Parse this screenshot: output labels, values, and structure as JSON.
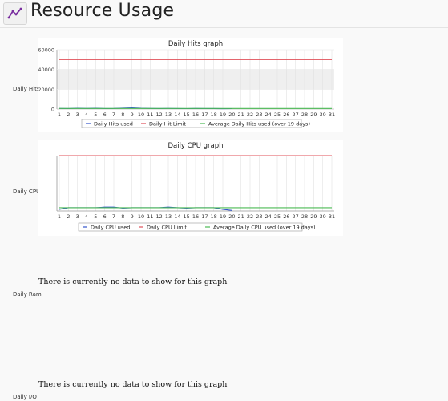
{
  "header": {
    "title": "Resource Usage",
    "icon": "chart-line-icon"
  },
  "rows": {
    "hits": {
      "label": "Daily Hits"
    },
    "cpu": {
      "label": "Daily CPU"
    },
    "ram": {
      "label": "Daily Ram",
      "no_data": "There is currently no data to show for this graph"
    },
    "io": {
      "label": "Daily I/O",
      "no_data": "There is currently no data to show for this graph"
    }
  },
  "chart_data": [
    {
      "type": "line",
      "title": "Daily Hits graph",
      "ylim": [
        0,
        60000
      ],
      "y_ticks": [
        "0",
        "20000",
        "40000",
        "60000"
      ],
      "x": [
        "1",
        "2",
        "3",
        "4",
        "5",
        "6",
        "7",
        "8",
        "9",
        "10",
        "11",
        "12",
        "13",
        "14",
        "15",
        "16",
        "17",
        "18",
        "19",
        "20",
        "21",
        "22",
        "23",
        "24",
        "25",
        "26",
        "27",
        "28",
        "29",
        "30",
        "31"
      ],
      "series": [
        {
          "name": "Daily Hits used",
          "color": "#3355cc",
          "values": [
            600,
            500,
            700,
            600,
            700,
            500,
            600,
            900,
            1100,
            700,
            600,
            500,
            600,
            500,
            400,
            600,
            500,
            500,
            300,
            400,
            null,
            null,
            null,
            null,
            null,
            null,
            null,
            null,
            null,
            null,
            null
          ]
        },
        {
          "name": "Daily Hit Limit",
          "color": "#e0505a",
          "values": [
            50000,
            50000,
            50000,
            50000,
            50000,
            50000,
            50000,
            50000,
            50000,
            50000,
            50000,
            50000,
            50000,
            50000,
            50000,
            50000,
            50000,
            50000,
            50000,
            50000,
            50000,
            50000,
            50000,
            50000,
            50000,
            50000,
            50000,
            50000,
            50000,
            50000,
            50000
          ]
        },
        {
          "name": "Average Daily Hits used (over 19 days)",
          "color": "#4cbb55",
          "values": [
            550,
            550,
            550,
            550,
            550,
            550,
            550,
            550,
            550,
            550,
            550,
            550,
            550,
            550,
            550,
            550,
            550,
            550,
            550,
            550,
            550,
            550,
            550,
            550,
            550,
            550,
            550,
            550,
            550,
            550,
            550
          ]
        }
      ],
      "grid": true,
      "legend_position": "bottom"
    },
    {
      "type": "line",
      "title": "Daily CPU graph",
      "ylim": [
        0,
        100
      ],
      "x": [
        "1",
        "2",
        "3",
        "4",
        "5",
        "6",
        "7",
        "8",
        "9",
        "10",
        "11",
        "12",
        "13",
        "14",
        "15",
        "16",
        "17",
        "18",
        "19",
        "20",
        "21",
        "22",
        "23",
        "24",
        "25",
        "26",
        "27",
        "28",
        "29",
        "30",
        "31"
      ],
      "series": [
        {
          "name": "Daily CPU used",
          "color": "#3355cc",
          "values": [
            3,
            6,
            6,
            6,
            6,
            7,
            7,
            5,
            6,
            6,
            6,
            6,
            7,
            6,
            5,
            6,
            6,
            6,
            3,
            1,
            null,
            null,
            null,
            null,
            null,
            null,
            null,
            null,
            null,
            null,
            null
          ]
        },
        {
          "name": "Daily CPU Limit",
          "color": "#e0505a",
          "values": [
            100,
            100,
            100,
            100,
            100,
            100,
            100,
            100,
            100,
            100,
            100,
            100,
            100,
            100,
            100,
            100,
            100,
            100,
            100,
            100,
            100,
            100,
            100,
            100,
            100,
            100,
            100,
            100,
            100,
            100,
            100
          ]
        },
        {
          "name": "Average Daily CPU used (over 19 days)",
          "color": "#4cbb55",
          "values": [
            6,
            6,
            6,
            6,
            6,
            6,
            6,
            6,
            6,
            6,
            6,
            6,
            6,
            6,
            6,
            6,
            6,
            6,
            6,
            6,
            6,
            6,
            6,
            6,
            6,
            6,
            6,
            6,
            6,
            6,
            6
          ]
        }
      ],
      "grid": true,
      "legend_position": "bottom"
    }
  ]
}
